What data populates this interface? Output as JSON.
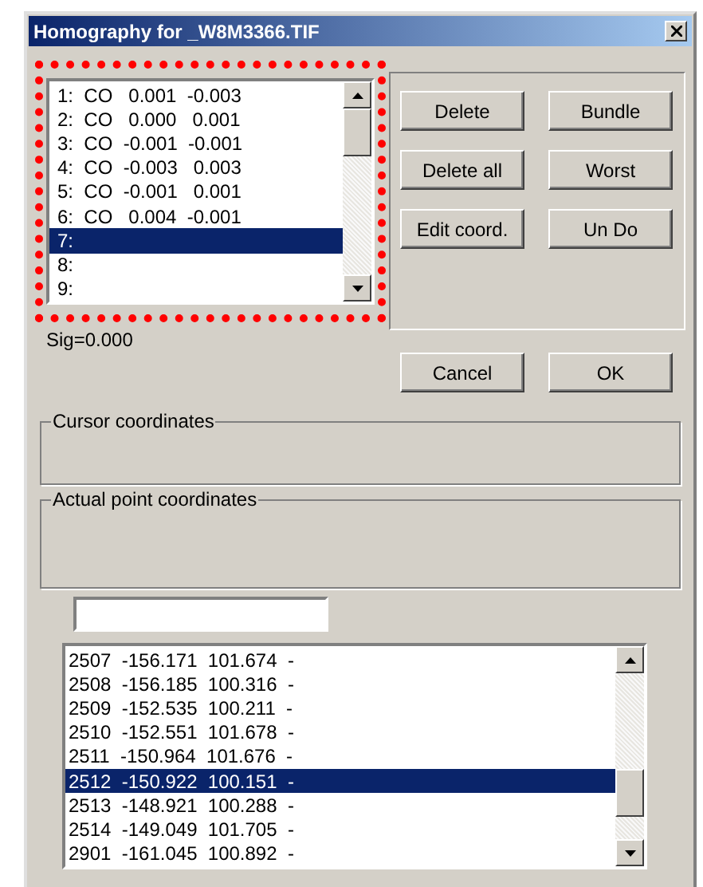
{
  "window": {
    "title": "Homography for _W8M3366.TIF"
  },
  "point_list": {
    "items": [
      {
        "text": "1:  CO   0.001  -0.003",
        "selected": false
      },
      {
        "text": "2:  CO   0.000   0.001",
        "selected": false
      },
      {
        "text": "3:  CO  -0.001  -0.001",
        "selected": false
      },
      {
        "text": "4:  CO  -0.003   0.003",
        "selected": false
      },
      {
        "text": "5:  CO  -0.001   0.001",
        "selected": false
      },
      {
        "text": "6:  CO   0.004  -0.001",
        "selected": false
      },
      {
        "text": "7:",
        "selected": true
      },
      {
        "text": "8:",
        "selected": false
      },
      {
        "text": "9:",
        "selected": false
      }
    ]
  },
  "action_buttons": [
    "Delete",
    "Bundle",
    "Delete all",
    "Worst",
    "Edit coord.",
    "Un Do"
  ],
  "sigma": "Sig=0.000",
  "dialog_buttons": [
    "Cancel",
    "OK"
  ],
  "groups": [
    "Cursor coordinates",
    "Actual point coordinates"
  ],
  "coordinate_list": {
    "items": [
      {
        "text": "2507  -156.171  101.674  -",
        "selected": false
      },
      {
        "text": "2508  -156.185  100.316  -",
        "selected": false
      },
      {
        "text": "2509  -152.535  100.211  -",
        "selected": false
      },
      {
        "text": "2510  -152.551  101.678  -",
        "selected": false
      },
      {
        "text": "2511  -150.964  101.676  -",
        "selected": false
      },
      {
        "text": "2512  -150.922  100.151  -",
        "selected": true
      },
      {
        "text": "2513  -148.921  100.288  -",
        "selected": false
      },
      {
        "text": "2514  -149.049  101.705  -",
        "selected": false
      },
      {
        "text": "2901  -161.045  100.892  -",
        "selected": false
      }
    ]
  }
}
